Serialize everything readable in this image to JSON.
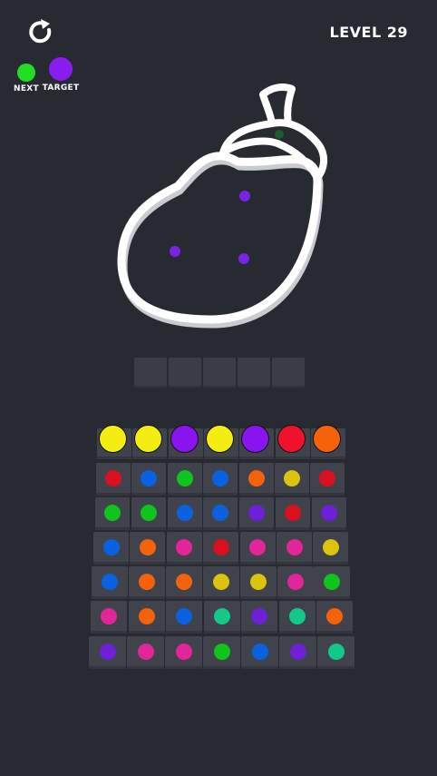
{
  "header": {
    "level_text": "LEVEL 29",
    "restart_icon": "restart-icon"
  },
  "legend": {
    "next_label": "NEXT",
    "next_color": "#22dd22",
    "target_label": "TARGET",
    "target_color": "#8a1ef0"
  },
  "figure": {
    "shape": "eggplant outline",
    "dot_colors": [
      "#7a22e6",
      "#7a22e6",
      "#7a22e6",
      "#1e5e2a"
    ]
  },
  "slots": {
    "count": 5,
    "filled": 0
  },
  "palette": {
    "yellow": "#f3ee0f",
    "purple": "#8a14f0",
    "red": "#f0122b",
    "orange": "#f5620a",
    "green": "#10c41e",
    "blue": "#0a62e0",
    "pink": "#e3259a",
    "teal": "#12c98a",
    "dkred": "#d8101f",
    "dkpurple": "#6e1fd8",
    "dkyellow": "#dcc40d"
  },
  "front_row": [
    "yellow",
    "yellow",
    "purple",
    "yellow",
    "purple",
    "red",
    "orange"
  ],
  "grid": [
    [
      "dkred",
      "blue",
      "green",
      "blue",
      "orange",
      "dkyellow",
      "dkred"
    ],
    [
      "green",
      "green",
      "blue",
      "blue",
      "dkpurple",
      "dkred",
      "dkpurple"
    ],
    [
      "blue",
      "orange",
      "pink",
      "dkred",
      "pink",
      "pink",
      "dkyellow"
    ],
    [
      "blue",
      "orange",
      "orange",
      "dkyellow",
      "dkyellow",
      "pink",
      "green"
    ],
    [
      "pink",
      "orange",
      "blue",
      "teal",
      "dkpurple",
      "teal",
      "orange"
    ],
    [
      "dkpurple",
      "pink",
      "pink",
      "green",
      "blue",
      "dkpurple",
      "teal"
    ]
  ]
}
